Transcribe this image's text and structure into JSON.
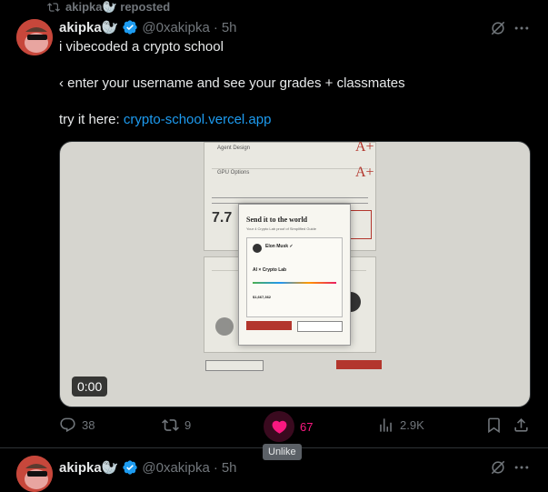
{
  "repost": {
    "label": "akipka🦭 reposted"
  },
  "tweets": [
    {
      "author_name": "akipka🦭",
      "handle": "@0xakipka",
      "dot": "·",
      "time": "5h",
      "lines": [
        "i vibecoded a crypto school",
        "‹ enter your username and see your grades + classmates"
      ],
      "try_prefix": "try it here:",
      "link": "crypto-school.vercel.app",
      "video_time": "0:00",
      "actions": {
        "replies": "38",
        "reposts": "9",
        "likes": "67",
        "views": "2.9K"
      },
      "tooltip": "Unlike"
    },
    {
      "author_name": "akipka🦭",
      "handle": "@0xakipka",
      "dot": "·",
      "time": "5h"
    }
  ],
  "media": {
    "card1_title": "Agent Design",
    "card2_title": "GPU Options",
    "grade": "A+",
    "score": "7.7",
    "modal_title": "Send it to the world",
    "modal_sub": "Your 4 Crypto Lab proof of Simplified Guide",
    "profile_name": "Elon Musk ✓",
    "lab_title": "AI × Crypto Lab",
    "stat_label": "$1,667,362"
  },
  "colors": {
    "like": "#f91880",
    "link": "#1d9bf0",
    "verified": "#1d9bf0"
  }
}
